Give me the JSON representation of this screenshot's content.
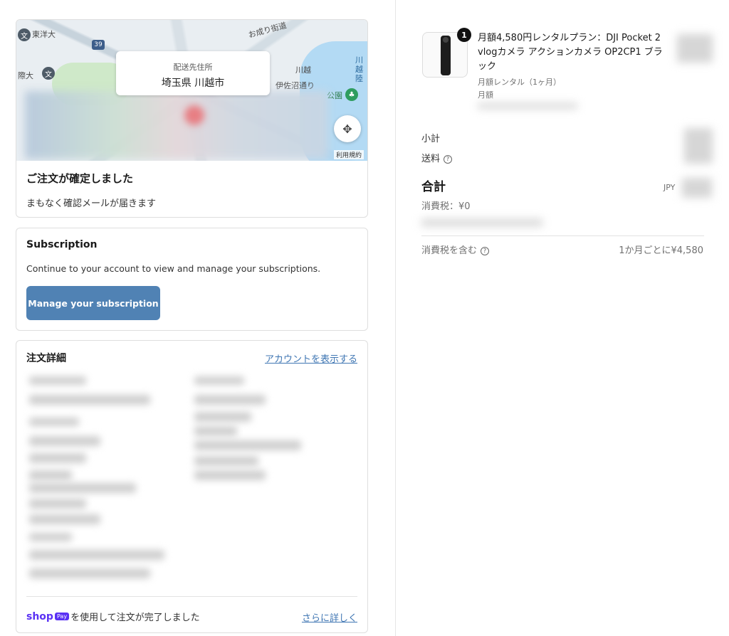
{
  "map": {
    "labels": {
      "toyo": "東洋大",
      "saiin": "際大",
      "oyari": "お成り街道",
      "kawagoe": "川越",
      "kawagoe_riku": "川越\n陸",
      "isanuma": "伊佐沼通り",
      "park": "公園",
      "route": "39"
    },
    "popup": {
      "title": "配送先住所",
      "address": "埼玉県 川越市"
    },
    "terms": "利用規約"
  },
  "confirmation": {
    "title": "ご注文が確定しました",
    "message": "まもなく確認メールが届きます"
  },
  "subscription": {
    "title": "Subscription",
    "description": "Continue to your account to view and manage your subscriptions.",
    "button": "Manage your subscription"
  },
  "order_details": {
    "title": "注文詳細",
    "account_link": "アカウントを表示する",
    "shop_logo": "shop",
    "shop_pay": "Pay",
    "shop_text": "を使用して注文が完了しました",
    "more_link": "さらに詳しく"
  },
  "summary": {
    "quantity": "1",
    "product_name": "月額4,580円レンタルプラン：DJI Pocket 2 vlogカメラ アクションカメラ OP2CP1 ブラック",
    "meta1": "月額レンタル（1ヶ月）",
    "meta2": "月額",
    "subtotal_label": "小計",
    "shipping_label": "送料",
    "total_label": "合計",
    "currency": "JPY",
    "tax_line": "消費税：¥0",
    "tax_included": "消費税を含む",
    "per_month": "1か月ごとに¥4,580"
  }
}
